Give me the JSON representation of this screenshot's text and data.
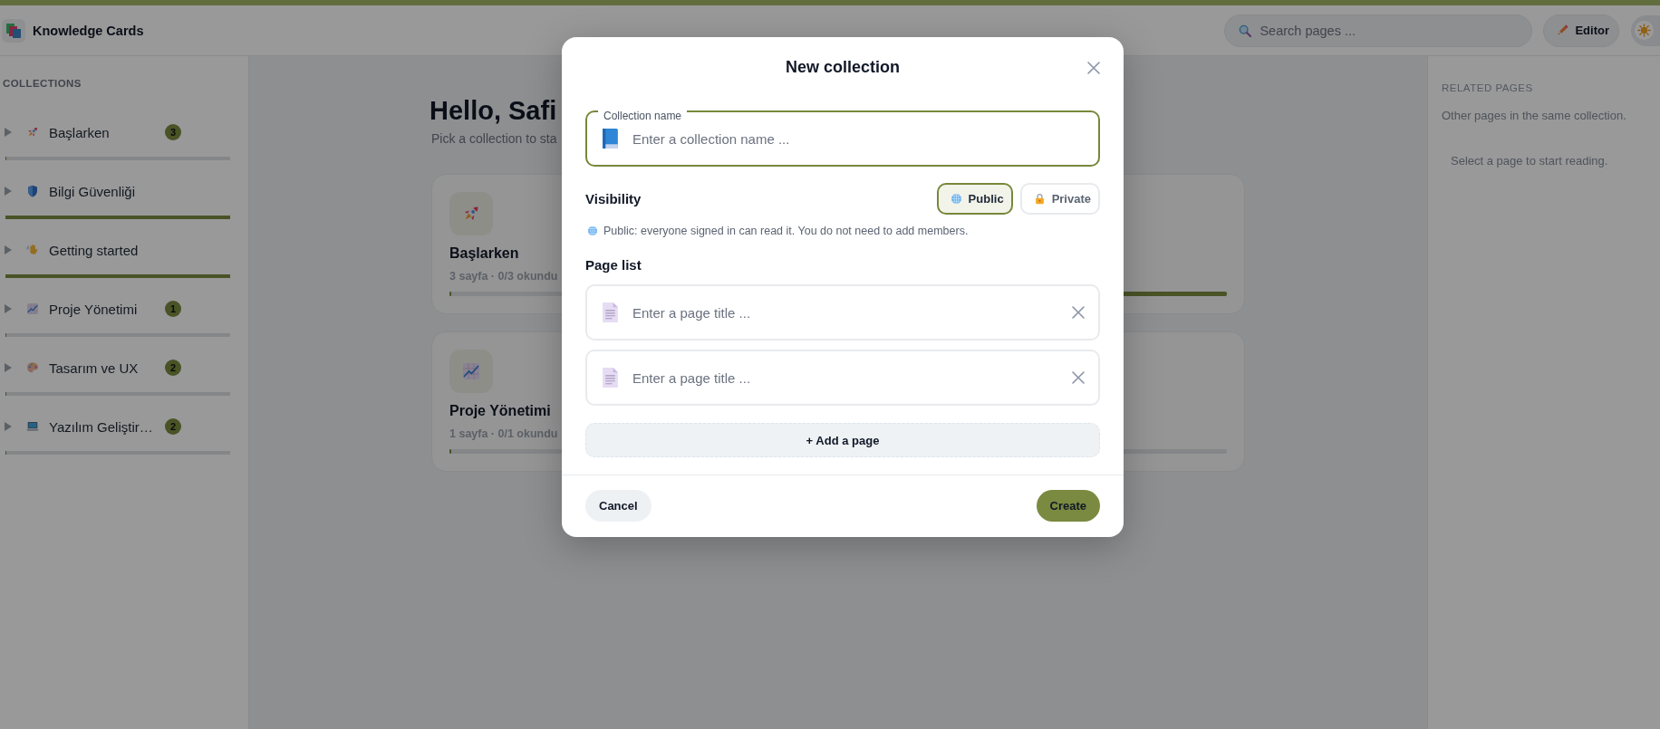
{
  "header": {
    "title": "Knowledge Cards",
    "search": {
      "placeholder": "Search pages ..."
    },
    "editor_button": "Editor",
    "theme_toggle": {
      "on": false
    }
  },
  "sidebar": {
    "heading": "COLLECTIONS",
    "items": [
      {
        "label": "Başlarken",
        "badge": "3",
        "level": 0,
        "expanded": false
      },
      {
        "label": "Bilgi Güvenliği",
        "level": 1,
        "expanded": false
      },
      {
        "label": "Getting started",
        "level": 1,
        "expanded": false
      },
      {
        "label": "Proje Yönetimi",
        "badge": "1",
        "level": 0,
        "expanded": false
      },
      {
        "label": "Tasarım ve UX",
        "badge": "2",
        "level": 0,
        "expanded": false
      },
      {
        "label": "Yazılım Geliştir…",
        "badge": "2",
        "level": 0,
        "expanded": false
      }
    ]
  },
  "main": {
    "heading": "Hello, Safi",
    "subtitle": "Pick a collection to sta",
    "cards": [
      {
        "title": "Başlarken",
        "meta": "3 sayfa · 0/3 okundu",
        "level": 0
      },
      {
        "level": 1
      },
      {
        "title": "Proje Yönetimi",
        "meta": "1 sayfa · 0/1 okundu",
        "level": 0
      },
      {
        "level": 0
      }
    ]
  },
  "related": {
    "heading": "RELATED PAGES",
    "description": "Other pages in the same collection.",
    "empty_text": "Select a page to start reading."
  },
  "modal": {
    "title": "New collection",
    "name_field": {
      "label": "Collection name",
      "placeholder": "Enter a collection name ..."
    },
    "visibility": {
      "label": "Visibility",
      "options": [
        {
          "label": "Public",
          "selected": true
        },
        {
          "label": "Private",
          "selected": false
        }
      ],
      "hint": "Public: everyone signed in can read it. You do not need to add members."
    },
    "page_list": {
      "label": "Page list",
      "pages": [
        {
          "placeholder": "Enter a page title ..."
        },
        {
          "placeholder": "Enter a page title ..."
        }
      ],
      "add_button": "+ Add a page"
    },
    "cancel_button": "Cancel",
    "create_button": "Create"
  }
}
